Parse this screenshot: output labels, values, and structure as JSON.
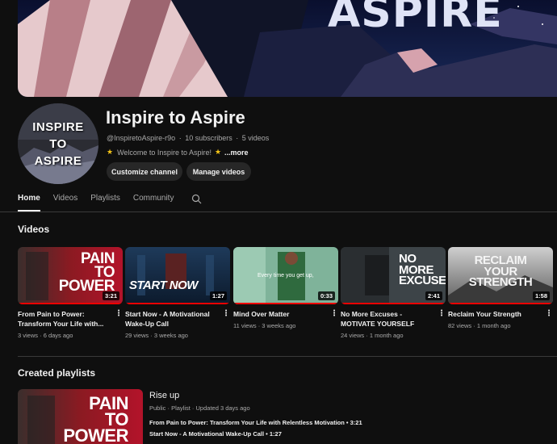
{
  "banner": {
    "text": "ASPIRE"
  },
  "channel": {
    "avatar_lines": [
      "INSPIRE",
      "TO",
      "ASPIRE"
    ],
    "title": "Inspire to Aspire",
    "handle": "@InspiretoAspire-r9o",
    "subscribers": "10 subscribers",
    "videos_count": "5 videos",
    "separator": "·",
    "description": "Welcome to Inspire to Aspire!",
    "more": "...more",
    "customize_label": "Customize channel",
    "manage_label": "Manage videos"
  },
  "tabs": [
    "Home",
    "Videos",
    "Playlists",
    "Community"
  ],
  "sections": {
    "videos": "Videos",
    "playlists": "Created playlists"
  },
  "videos": [
    {
      "title": "From Pain to Power: Transform Your Life with...",
      "views": "3 views",
      "age": "6 days ago",
      "duration": "3:21",
      "thumb_text": [
        "PAIN",
        "TO",
        "POWER"
      ]
    },
    {
      "title": "Start Now - A Motivational Wake-Up Call",
      "views": "29 views",
      "age": "3 weeks ago",
      "duration": "1:27",
      "thumb_text": [
        "START NOW"
      ]
    },
    {
      "title": "Mind Over Matter",
      "views": "11 views",
      "age": "3 weeks ago",
      "duration": "0:33",
      "thumb_text": [
        "Every time you get up,"
      ]
    },
    {
      "title": "No More Excuses - MOTIVATE YOURSELF",
      "views": "24 views",
      "age": "1 month ago",
      "duration": "2:41",
      "thumb_text": [
        "NO",
        "MORE",
        "EXCUSES"
      ]
    },
    {
      "title": "Reclaim Your Strength",
      "views": "82 views",
      "age": "1 month ago",
      "duration": "1:58",
      "thumb_text": [
        "RECLAIM",
        "YOUR",
        "STRENGTH"
      ]
    }
  ],
  "playlist": {
    "title": "Rise up",
    "meta": "Public · Playlist · Updated 3 days ago",
    "items": [
      "From Pain to Power: Transform Your Life with Relentless Motivation • 3:21",
      "Start Now - A Motivational Wake-Up Call • 1:27"
    ],
    "thumb_text": [
      "PAIN",
      "TO",
      "POWER"
    ]
  },
  "colors": {
    "background": "#0f0f0f",
    "progress": "#e00000",
    "star": "#f5c518"
  },
  "icons": {
    "search": "search-icon",
    "menu": "more-vert-icon",
    "star": "star-icon"
  }
}
